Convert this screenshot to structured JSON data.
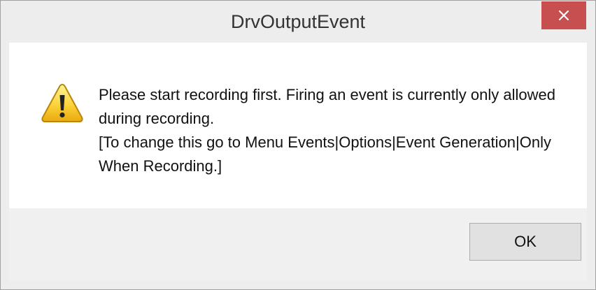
{
  "window": {
    "title": "DrvOutputEvent",
    "close_icon": "close-x-icon",
    "close_color": "#c74f4f"
  },
  "dialog": {
    "icon": "warning-icon",
    "message_line1": "Please start recording first. Firing an event is currently only allowed during recording.",
    "message_line2": "[To change this go to Menu Events|Options|Event Generation|Only When Recording.]"
  },
  "buttons": {
    "ok_label": "OK"
  }
}
